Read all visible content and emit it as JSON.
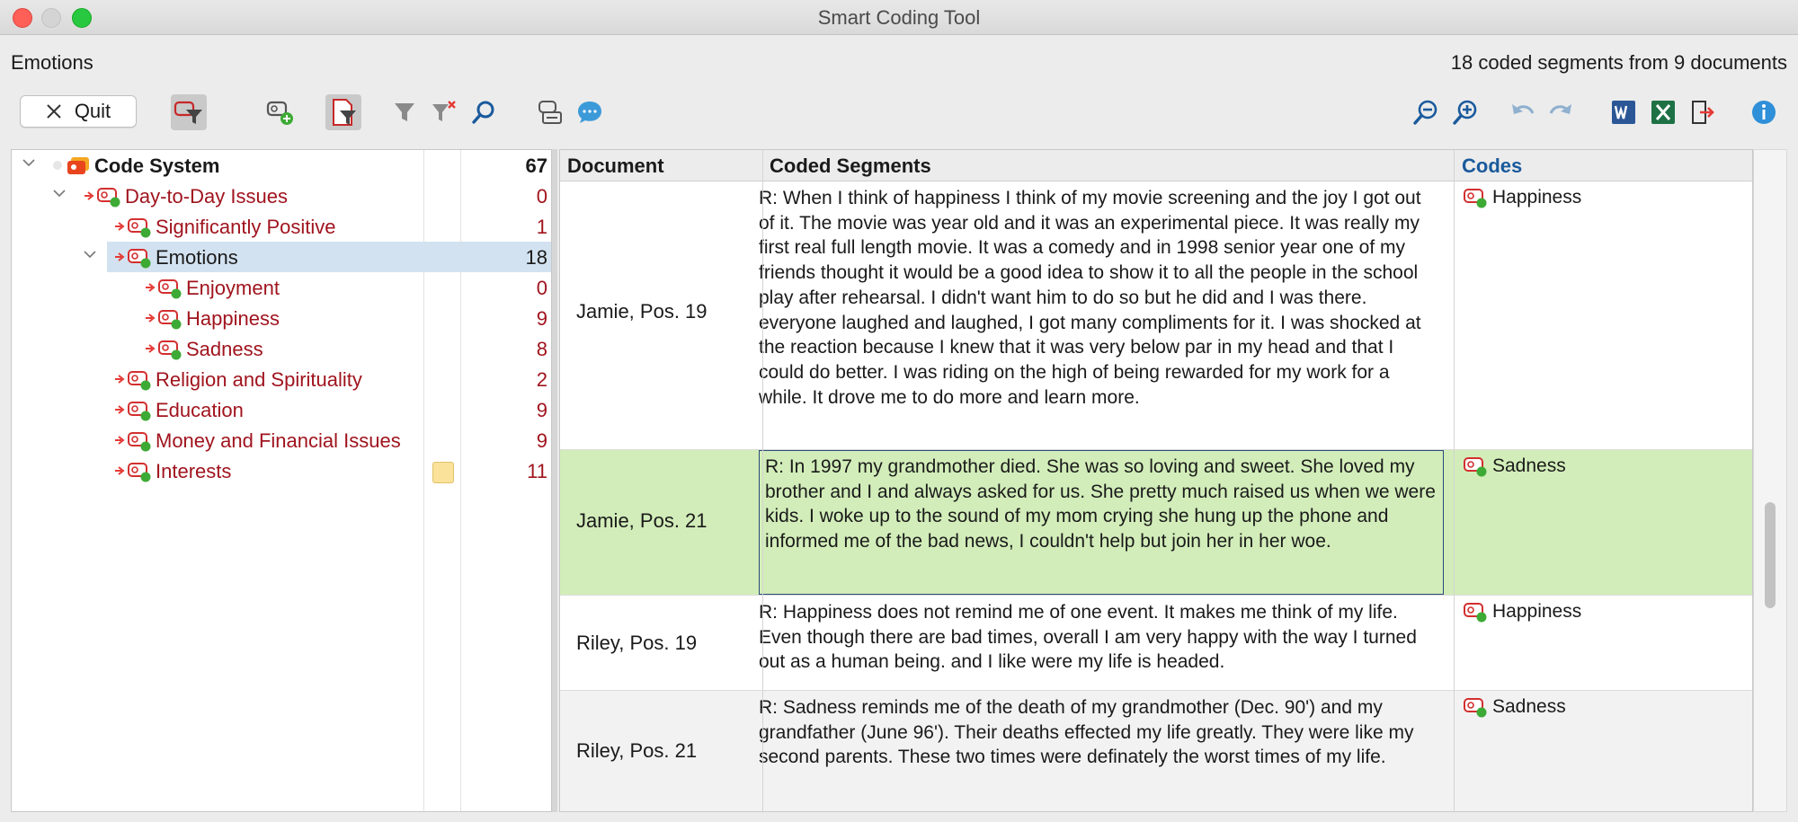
{
  "window": {
    "title": "Smart Coding Tool"
  },
  "header": {
    "left": "Emotions",
    "right": "18 coded segments from 9 documents"
  },
  "toolbar": {
    "quit_label": "Quit",
    "icons": [
      "filter-code-icon",
      "add-code-icon",
      "filter-document-icon",
      "filter-icon",
      "clear-filter-icon",
      "search-icon",
      "code-settings-icon",
      "comment-icon",
      "zoom-out-icon",
      "zoom-in-icon",
      "undo-icon",
      "redo-icon",
      "word-icon",
      "excel-icon",
      "export-icon",
      "info-icon"
    ]
  },
  "colors": {
    "accent": "#1a5a9c",
    "code_red": "#a0141e",
    "selection": "#d3e2f0",
    "row_highlight": "#d2edb9",
    "code_green": "#3daa35"
  },
  "tree": {
    "items": [
      {
        "label": "Code System",
        "count": "67",
        "level": 0
      },
      {
        "label": "Day-to-Day Issues",
        "count": "0",
        "level": 1
      },
      {
        "label": "Significantly Positive",
        "count": "1",
        "level": 2
      },
      {
        "label": "Emotions",
        "count": "18",
        "level": 2,
        "selected": true
      },
      {
        "label": "Enjoyment",
        "count": "0",
        "level": 3
      },
      {
        "label": "Happiness",
        "count": "9",
        "level": 3
      },
      {
        "label": "Sadness",
        "count": "8",
        "level": 3
      },
      {
        "label": "Religion and Spirituality",
        "count": "2",
        "level": 2
      },
      {
        "label": "Education",
        "count": "9",
        "level": 2
      },
      {
        "label": "Money and Financial Issues",
        "count": "9",
        "level": 2
      },
      {
        "label": "Interests",
        "count": "11",
        "level": 2,
        "memo": true
      }
    ]
  },
  "table": {
    "headers": {
      "document": "Document",
      "segments": "Coded Segments",
      "codes": "Codes"
    },
    "rows": [
      {
        "document": "Jamie, Pos. 19",
        "segment": "R: When I think of happiness I think of my movie screening and the joy I got out of it. The movie was year old and it was an experimental piece. It was really my first real full length movie. It was a comedy and in 1998 senior year one of my friends thought it would be a good idea to show it to all the people in the school play after rehearsal. I didn't want him to do so but he did and I was there. everyone laughed and laughed, I got many compliments for it. I was shocked at the reaction because I knew that it was very below par in my head and that I could do better. I was riding on the high of being rewarded for my work for a while. It drove me to do more and learn more.",
        "code": "Happiness"
      },
      {
        "document": "Jamie, Pos. 21",
        "segment": "R: In 1997 my grandmother died. She was so loving and sweet. She loved my brother and I and always asked for us. She pretty much raised us when we were kids. I woke up to the sound of my mom crying she hung up the phone and informed me of the bad news, I couldn't help but join her in her woe.",
        "code": "Sadness"
      },
      {
        "document": "Riley, Pos. 19",
        "segment": "R: Happiness does not remind me of one event. It makes me think of my life. Even though there are bad times, overall I am very happy with the way I turned out as a human being. and I like were my life is headed.",
        "code": "Happiness"
      },
      {
        "document": "Riley, Pos. 21",
        "segment": "R: Sadness reminds me of the death of my grandmother (Dec. 90') and my grandfather (June 96'). Their deaths effected my life greatly. They were like my second parents. These two times were definately the worst times of my life.",
        "code": "Sadness"
      }
    ]
  }
}
